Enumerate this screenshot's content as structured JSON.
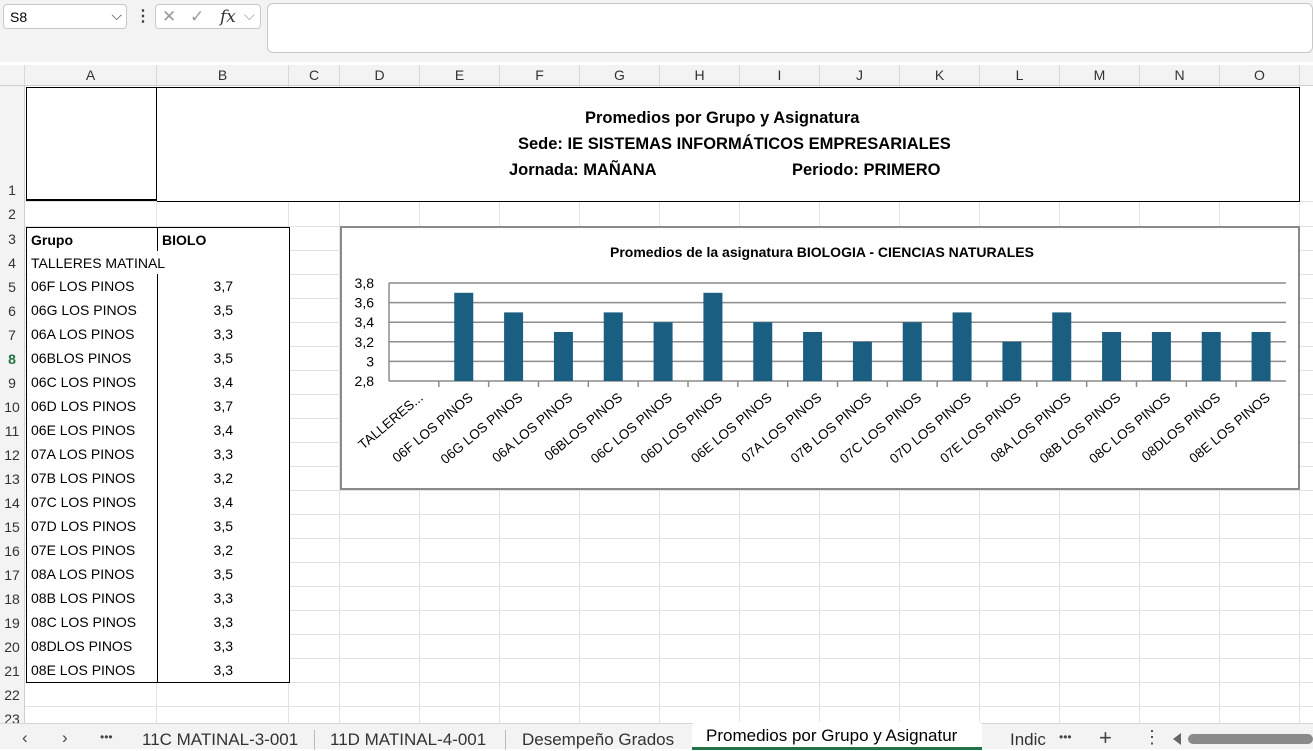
{
  "formula_bar": {
    "cell_ref": "S8",
    "dropdown_glyph": "⌵",
    "dots": "⋮",
    "cancel_glyph": "✕",
    "enter_glyph": "✓",
    "fx_glyph": "fx",
    "fx_dropdown_glyph": "⌵",
    "formula": ""
  },
  "columns": [
    "A",
    "B",
    "C",
    "D",
    "E",
    "F",
    "G",
    "H",
    "I",
    "J",
    "K",
    "L",
    "M",
    "N",
    "O"
  ],
  "rows": [
    "1",
    "2",
    "3",
    "4",
    "5",
    "6",
    "7",
    "8",
    "9",
    "10",
    "11",
    "12",
    "13",
    "14",
    "15",
    "16",
    "17",
    "18",
    "19",
    "20",
    "21",
    "22",
    "23"
  ],
  "header_block": {
    "line1": "Promedios por Grupo y Asignatura",
    "line2": "Sede: IE SISTEMAS INFORMÁTICOS EMPRESARIALES",
    "jornada": "Jornada: MAÑANA",
    "periodo": "Periodo: PRIMERO"
  },
  "table": {
    "header_grupo": "Grupo",
    "header_subject": "BIOLO",
    "section_label": "TALLERES MATINAL",
    "rows": [
      {
        "grupo": "06F LOS PINOS",
        "valor": "3,7"
      },
      {
        "grupo": "06G LOS PINOS",
        "valor": "3,5"
      },
      {
        "grupo": "06A LOS PINOS",
        "valor": "3,3"
      },
      {
        "grupo": "06BLOS PINOS",
        "valor": "3,5"
      },
      {
        "grupo": "06C LOS PINOS",
        "valor": "3,4"
      },
      {
        "grupo": "06D LOS PINOS",
        "valor": "3,7"
      },
      {
        "grupo": "06E LOS PINOS",
        "valor": "3,4"
      },
      {
        "grupo": "07A LOS PINOS",
        "valor": "3,3"
      },
      {
        "grupo": "07B LOS PINOS",
        "valor": "3,2"
      },
      {
        "grupo": "07C LOS PINOS",
        "valor": "3,4"
      },
      {
        "grupo": "07D LOS PINOS",
        "valor": "3,5"
      },
      {
        "grupo": "07E LOS PINOS",
        "valor": "3,2"
      },
      {
        "grupo": "08A LOS PINOS",
        "valor": "3,5"
      },
      {
        "grupo": "08B LOS PINOS",
        "valor": "3,3"
      },
      {
        "grupo": "08C LOS PINOS",
        "valor": "3,3"
      },
      {
        "grupo": "08DLOS PINOS",
        "valor": "3,3"
      },
      {
        "grupo": "08E LOS PINOS",
        "valor": "3,3"
      }
    ]
  },
  "chart_data": {
    "type": "bar",
    "title": "Promedios de la asignatura BIOLOGIA - CIENCIAS NATURALES",
    "categories": [
      "TALLERES...",
      "06F LOS PINOS",
      "06G LOS PINOS",
      "06A LOS PINOS",
      "06BLOS PINOS",
      "06C LOS PINOS",
      "06D LOS PINOS",
      "06E LOS PINOS",
      "07A LOS PINOS",
      "07B LOS PINOS",
      "07C LOS PINOS",
      "07D LOS PINOS",
      "07E LOS PINOS",
      "08A LOS PINOS",
      "08B LOS PINOS",
      "08C LOS PINOS",
      "08DLOS PINOS",
      "08E LOS PINOS"
    ],
    "values": [
      null,
      3.7,
      3.5,
      3.3,
      3.5,
      3.4,
      3.7,
      3.4,
      3.3,
      3.2,
      3.4,
      3.5,
      3.2,
      3.5,
      3.3,
      3.3,
      3.3,
      3.3
    ],
    "ylim": [
      2.8,
      3.8
    ],
    "yticks": [
      "2,8",
      "3",
      "3,2",
      "3,4",
      "3,6",
      "3,8"
    ],
    "ytick_values": [
      2.8,
      3.0,
      3.2,
      3.4,
      3.6,
      3.8
    ],
    "grid": true,
    "legend": "none",
    "bar_color": "#1a5f82"
  },
  "tabs": {
    "prev_glyph": "‹",
    "next_glyph": "›",
    "more_glyph": "•••",
    "items": [
      "11C MATINAL-3-001",
      "11D MATINAL-4-001",
      "Desempeño Grados",
      "Promedios por Grupo y Asignatur",
      "Indic"
    ],
    "active_index": 3,
    "more2_glyph": "•••",
    "add_glyph": "+",
    "options_glyph": "⋮"
  }
}
